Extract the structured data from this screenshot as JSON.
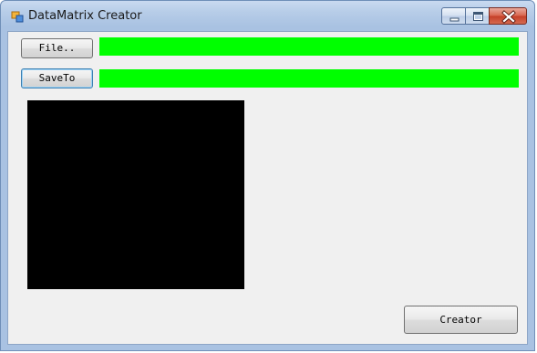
{
  "window": {
    "title": "DataMatrix Creator"
  },
  "icons": {
    "app": "app-icon",
    "minimize": "minimize-icon",
    "maximize": "maximize-icon",
    "close": "close-icon"
  },
  "buttons": {
    "file_label": "File..",
    "saveto_label": "SaveTo",
    "creator_label": "Creator"
  },
  "fields": {
    "file_path": "",
    "save_path": ""
  },
  "colors": {
    "path_field_background": "#00ff00",
    "matrix_preview_background": "#000000",
    "client_background": "#f0f0f0"
  }
}
